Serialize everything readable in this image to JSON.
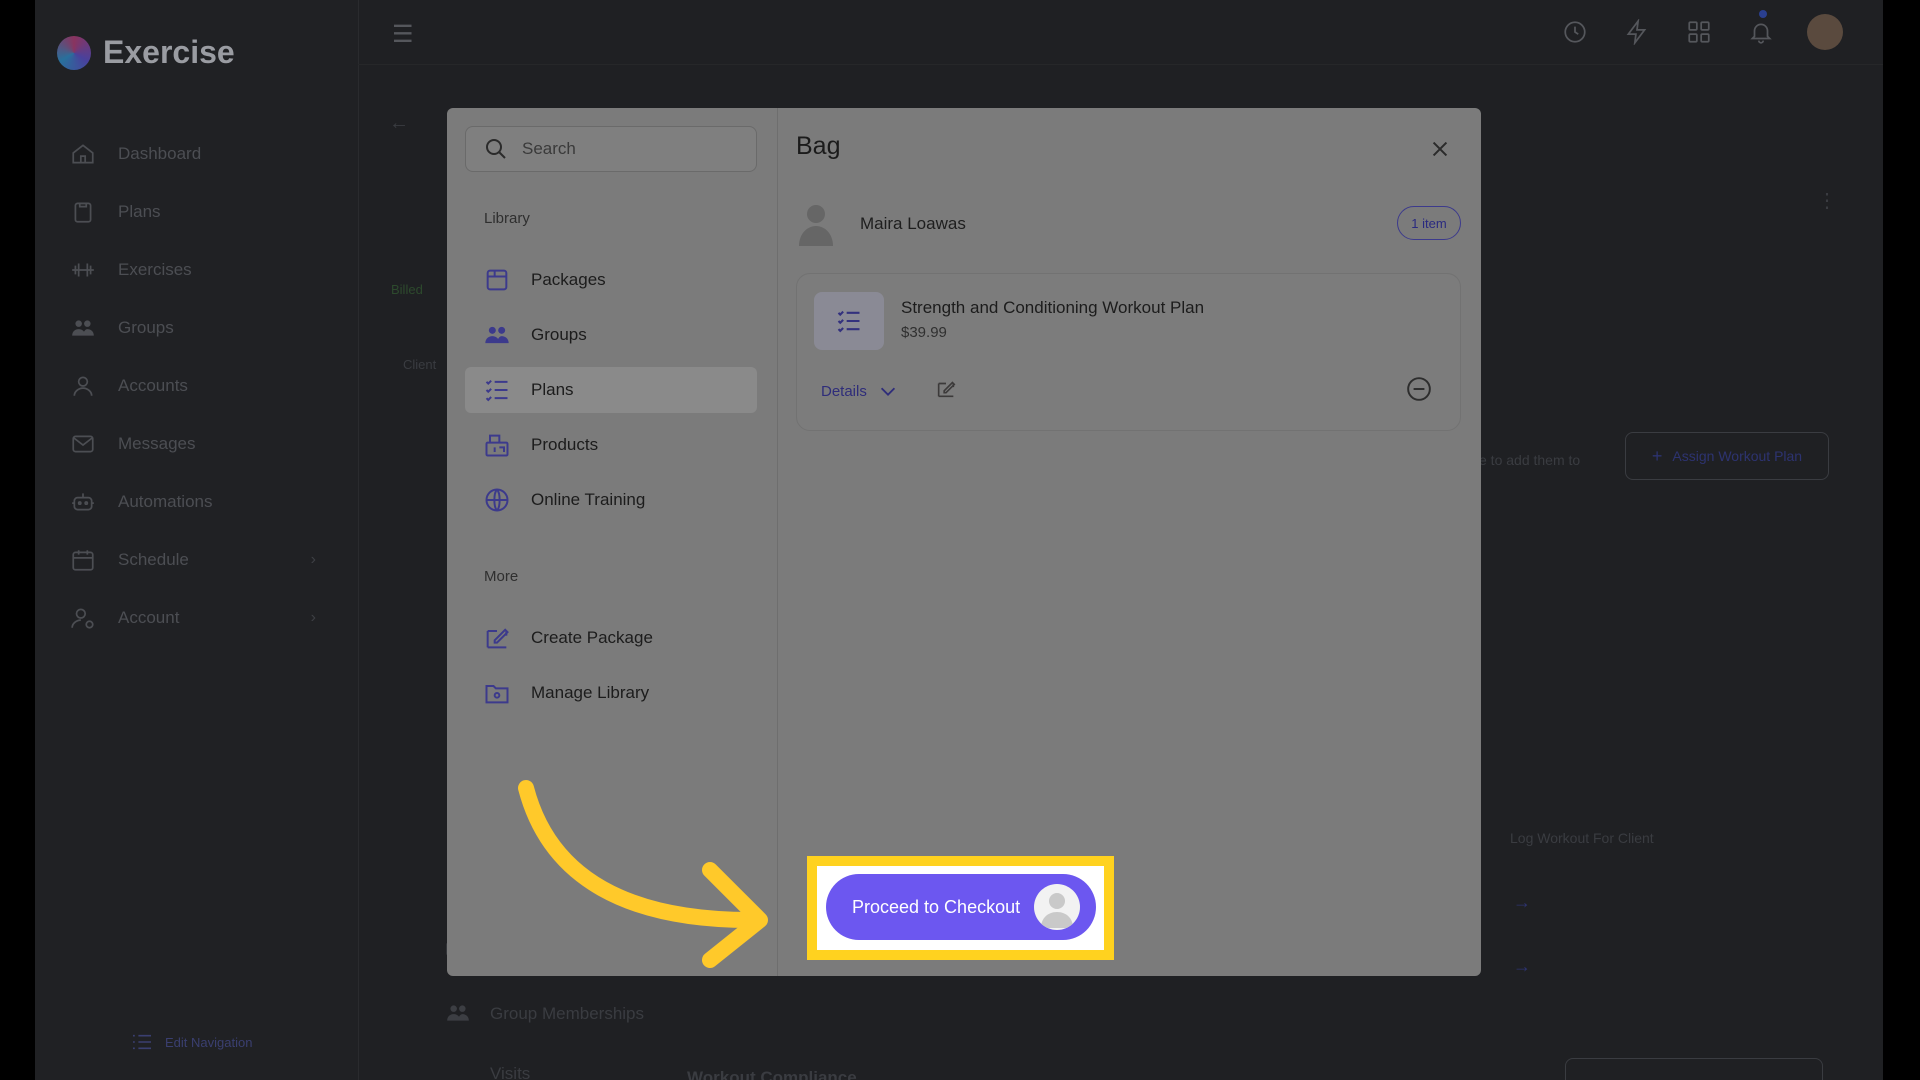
{
  "app": {
    "brand": "Exercise",
    "nav": [
      {
        "label": "Dashboard",
        "icon": "home-icon"
      },
      {
        "label": "Plans",
        "icon": "clipboard-icon"
      },
      {
        "label": "Exercises",
        "icon": "dumbbell-icon"
      },
      {
        "label": "Groups",
        "icon": "group-icon"
      },
      {
        "label": "Accounts",
        "icon": "user-icon"
      },
      {
        "label": "Messages",
        "icon": "mail-icon"
      },
      {
        "label": "Automations",
        "icon": "robot-icon"
      },
      {
        "label": "Schedule",
        "icon": "calendar-icon"
      },
      {
        "label": "Account",
        "icon": "user-gear-icon"
      }
    ],
    "edit_navigation": "Edit Navigation"
  },
  "background": {
    "billed": "Billed",
    "client": "Client",
    "add_hint": "e to add them to",
    "assign_button": "Assign Workout Plan",
    "log_workout": "Log Workout For Client",
    "group_memberships": "Group Memberships",
    "visits": "Visits",
    "workout_compliance": "Workout Compliance"
  },
  "modal": {
    "search_placeholder": "Search",
    "library_label": "Library",
    "library_items": [
      "Packages",
      "Groups",
      "Plans",
      "Products",
      "Online Training"
    ],
    "active_item": "Plans",
    "more_label": "More",
    "more_items": [
      "Create Package",
      "Manage Library"
    ],
    "bag": {
      "title": "Bag",
      "client_name": "Maira Loawas",
      "item_count": "1 item",
      "items": [
        {
          "name": "Strength and Conditioning Workout Plan",
          "price": "$39.99",
          "details_label": "Details"
        }
      ]
    },
    "checkout_label": "Proceed to Checkout"
  },
  "colors": {
    "accent": "#6c57f0",
    "highlight": "#ffd21f",
    "overlay": "#7b7b7b"
  }
}
